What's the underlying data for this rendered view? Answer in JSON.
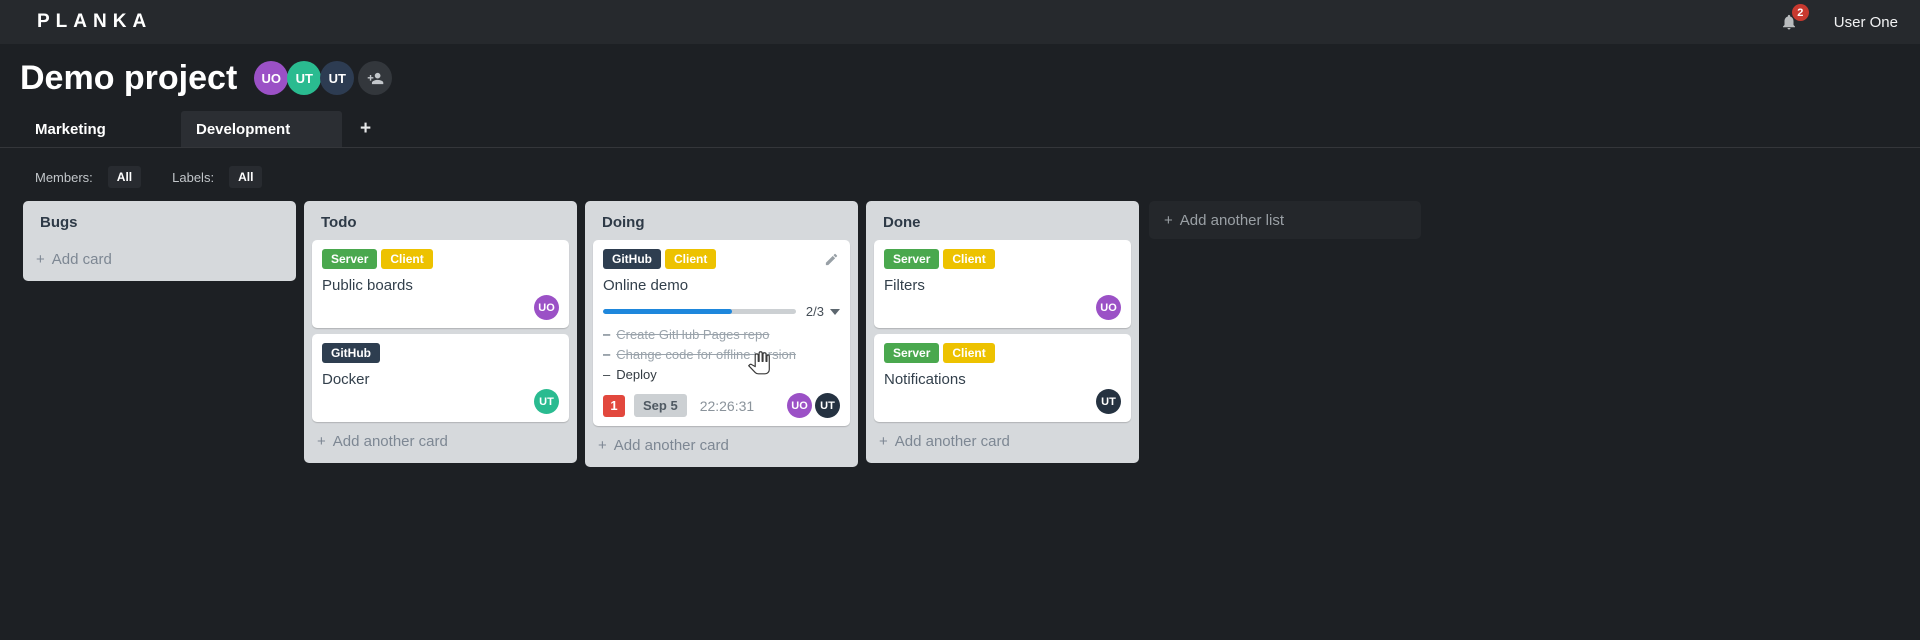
{
  "topbar": {
    "logo": "PLANKA",
    "notifications": {
      "count": "2"
    },
    "user_name": "User One"
  },
  "project": {
    "title": "Demo project",
    "members": [
      {
        "initials": "UO",
        "color": "#9b51c6"
      },
      {
        "initials": "UT",
        "color": "#2abb90"
      },
      {
        "initials": "UT",
        "color": "#2d3c52"
      }
    ]
  },
  "tabs": {
    "items": [
      {
        "label": "Marketing",
        "active": false
      },
      {
        "label": "Development",
        "active": true
      }
    ],
    "add_button": "+"
  },
  "filters": {
    "members_label": "Members:",
    "members_value": "All",
    "labels_label": "Labels:",
    "labels_value": "All"
  },
  "board": {
    "lists": [
      {
        "name": "Bugs",
        "add_label": "Add card",
        "cards": []
      },
      {
        "name": "Todo",
        "add_label": "Add another card",
        "cards": [
          {
            "title": "Public boards",
            "labels": [
              {
                "text": "Server",
                "color": "#4aa84e"
              },
              {
                "text": "Client",
                "color": "#edc200"
              }
            ],
            "members": [
              {
                "initials": "UO",
                "color": "#9b51c6"
              }
            ]
          },
          {
            "title": "Docker",
            "labels": [
              {
                "text": "GitHub",
                "color": "#2e3e50"
              }
            ],
            "members": [
              {
                "initials": "UT",
                "color": "#2abb90"
              }
            ]
          }
        ]
      },
      {
        "name": "Doing",
        "add_label": "Add another card",
        "cards": [
          {
            "title": "Online demo",
            "hovered": true,
            "labels": [
              {
                "text": "GitHub",
                "color": "#2e3e50"
              },
              {
                "text": "Client",
                "color": "#edc200"
              }
            ],
            "progress": {
              "value": 2,
              "total": 3,
              "label": "2/3",
              "color": "#1e87dc"
            },
            "tasks": [
              {
                "text": "Create GitHub Pages repo",
                "done": true
              },
              {
                "text": "Change code for offline version",
                "done": true
              },
              {
                "text": "Deploy",
                "done": false
              }
            ],
            "notification_count": "1",
            "notification_color": "#e2483d",
            "due_date": "Sep 5",
            "timer": "22:26:31",
            "members": [
              {
                "initials": "UO",
                "color": "#9b51c6"
              },
              {
                "initials": "UT",
                "color": "#253241"
              }
            ]
          }
        ]
      },
      {
        "name": "Done",
        "add_label": "Add another card",
        "cards": [
          {
            "title": "Filters",
            "labels": [
              {
                "text": "Server",
                "color": "#4aa84e"
              },
              {
                "text": "Client",
                "color": "#edc200"
              }
            ],
            "members": [
              {
                "initials": "UO",
                "color": "#9b51c6"
              }
            ]
          },
          {
            "title": "Notifications",
            "labels": [
              {
                "text": "Server",
                "color": "#4aa84e"
              },
              {
                "text": "Client",
                "color": "#edc200"
              }
            ],
            "members": [
              {
                "initials": "UT",
                "color": "#253241"
              }
            ]
          }
        ]
      }
    ],
    "add_list_label": "Add another list"
  }
}
